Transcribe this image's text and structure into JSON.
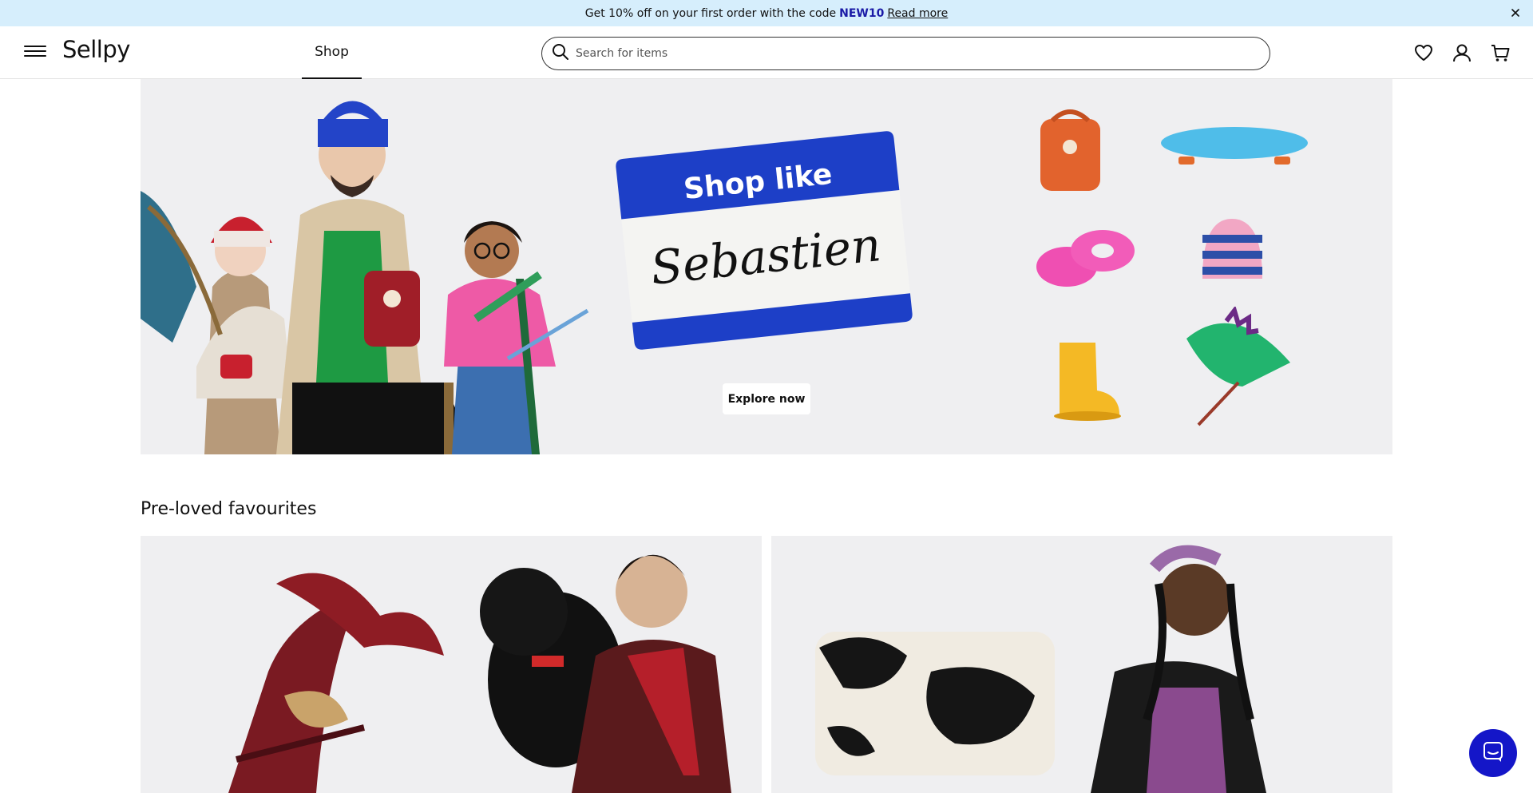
{
  "announcement": {
    "text": "Get 10% off on your first order with the code",
    "code": "NEW10",
    "link": "Read more"
  },
  "header": {
    "logo": "Sellpy",
    "nav_shop": "Shop",
    "search_placeholder": "Search for items"
  },
  "hero": {
    "sticker_top": "Shop like",
    "sticker_name": "Sebastien",
    "cta": "Explore now"
  },
  "section": {
    "title": "Pre-loved favourites"
  },
  "colors": {
    "announce_bg": "#d6eefc",
    "code_color": "#1a1aa6",
    "chat_blue": "#1416c8",
    "sticker_blue": "#1d3fc7"
  }
}
